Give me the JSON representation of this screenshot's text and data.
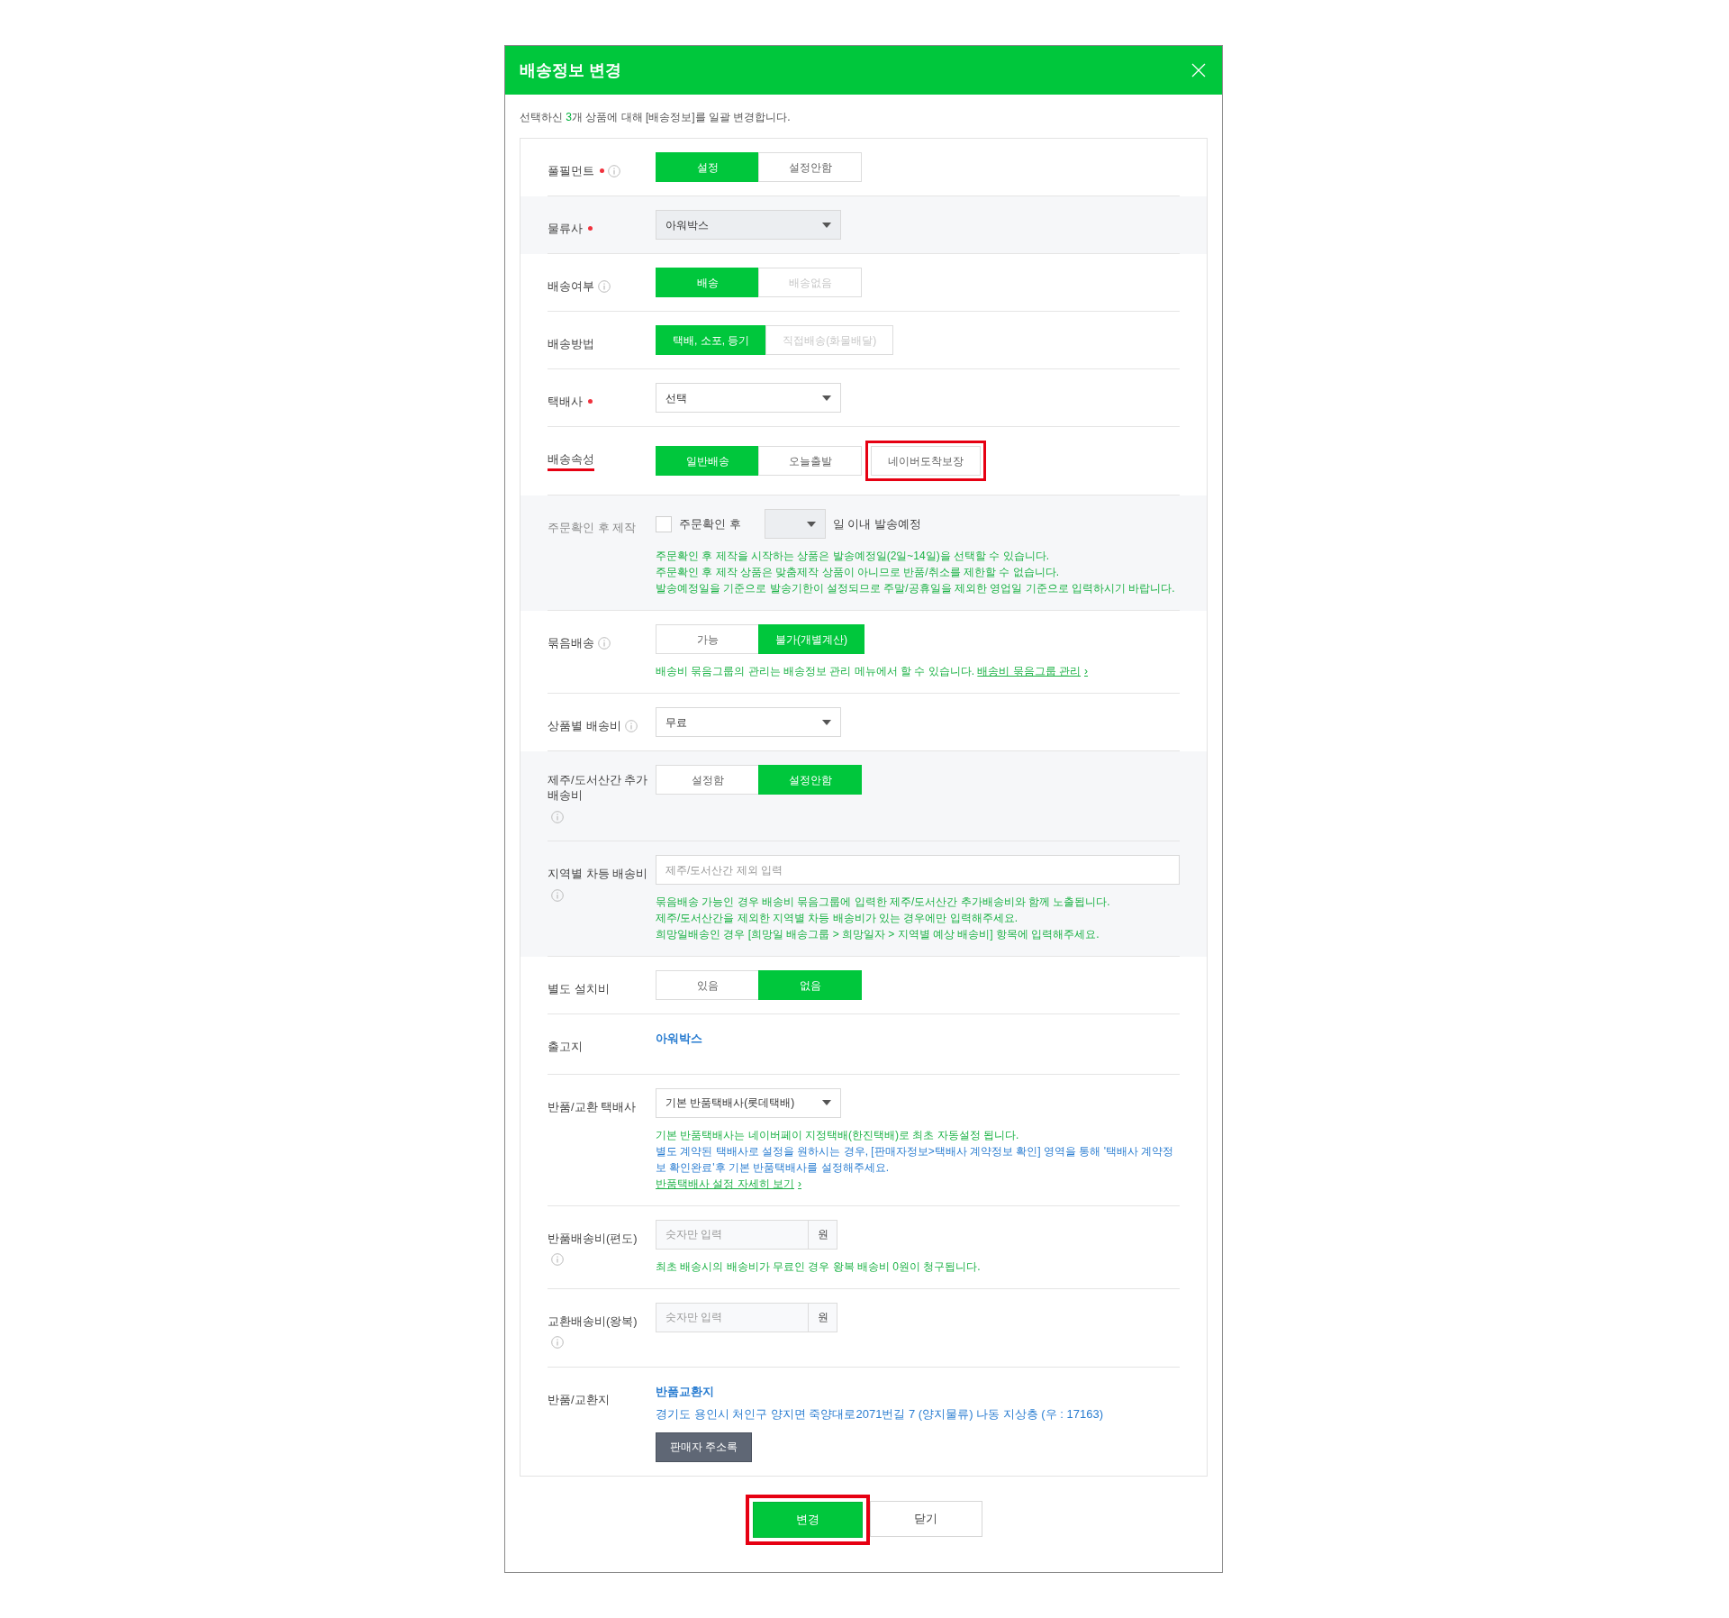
{
  "dialog": {
    "title": "배송정보 변경",
    "intro": {
      "before": "선택하신 ",
      "count": "3",
      "after": "개 상품에 대해 [배송정보]를 일괄 변경합니다."
    }
  },
  "rows": [
    {
      "kind": "segmented",
      "label": "풀필먼트",
      "required": true,
      "info": true,
      "shaded": false,
      "options": [
        {
          "label": "설정",
          "selected": true,
          "disabled": false,
          "highlighted": false
        },
        {
          "label": "설정안함",
          "selected": false,
          "disabled": false,
          "highlighted": false
        }
      ]
    },
    {
      "kind": "select",
      "label": "물류사",
      "required": true,
      "info": false,
      "shaded": true,
      "value": "아워박스",
      "disabled": true
    },
    {
      "kind": "segmented",
      "label": "배송여부",
      "required": false,
      "info": true,
      "shaded": false,
      "options": [
        {
          "label": "배송",
          "selected": true,
          "disabled": false,
          "highlighted": false
        },
        {
          "label": "배송없음",
          "selected": false,
          "disabled": true,
          "highlighted": false
        }
      ]
    },
    {
      "kind": "segmented",
      "label": "배송방법",
      "required": false,
      "info": false,
      "shaded": false,
      "options": [
        {
          "label": "택배, 소포, 등기",
          "selected": true,
          "disabled": false,
          "highlighted": false
        },
        {
          "label": "직접배송(화물배달)",
          "selected": false,
          "disabled": true,
          "highlighted": false
        }
      ]
    },
    {
      "kind": "select",
      "label": "택배사",
      "required": true,
      "info": false,
      "shaded": false,
      "value": "선택",
      "disabled": false
    },
    {
      "kind": "segmented",
      "label": "배송속성",
      "required": false,
      "info": false,
      "shaded": false,
      "underlined": true,
      "options": [
        {
          "label": "일반배송",
          "selected": true,
          "disabled": false,
          "highlighted": false
        },
        {
          "label": "오늘출발",
          "selected": false,
          "disabled": false,
          "highlighted": false
        },
        {
          "label": "네이버도착보장",
          "selected": false,
          "disabled": false,
          "highlighted": true
        }
      ]
    },
    {
      "kind": "lead_time",
      "label": "주문확인 후 제작",
      "muted": true,
      "required": false,
      "info": false,
      "shaded": true,
      "checked": false,
      "checkbox_label": "주문확인 후",
      "select_disabled": true,
      "suffix": "일 이내 발송예정",
      "notes": [
        {
          "text": "주문확인 후 제작을 시작하는 상품은 발송예정일(2일~14일)을 선택할 수 있습니다.",
          "color": "#1bb245"
        },
        {
          "text": "주문확인 후 제작 상품은 맞춤제작 상품이 아니므로 반품/취소를 제한할 수 없습니다.",
          "color": "#1bb245"
        },
        {
          "text": "발송예정일을 기준으로 발송기한이 설정되므로 주말/공휴일을 제외한 영업일 기준으로 입력하시기 바랍니다.",
          "color": "#1bb245"
        }
      ]
    },
    {
      "kind": "segmented",
      "label": "묶음배송",
      "required": false,
      "info": true,
      "shaded": false,
      "options": [
        {
          "label": "가능",
          "selected": false,
          "disabled": false,
          "highlighted": false
        },
        {
          "label": "불가(개별계산)",
          "selected": true,
          "disabled": false,
          "highlighted": false
        }
      ],
      "notes": [
        {
          "text": "배송비 묶음그룹의 관리는 배송정보 관리 메뉴에서 할 수 있습니다.",
          "link": "배송비 묶음그룹 관리",
          "arrow": "›",
          "color": "#1bb245"
        }
      ]
    },
    {
      "kind": "select",
      "label": "상품별 배송비",
      "required": false,
      "info": true,
      "shaded": false,
      "value": "무료",
      "disabled": false
    },
    {
      "kind": "segmented",
      "label": "제주/도서산간 추가 배송비",
      "required": false,
      "info": true,
      "shaded": true,
      "options": [
        {
          "label": "설정함",
          "selected": false,
          "disabled": false,
          "highlighted": false
        },
        {
          "label": "설정안함",
          "selected": true,
          "disabled": false,
          "highlighted": false
        }
      ]
    },
    {
      "kind": "input",
      "label": "지역별 차등 배송비",
      "required": false,
      "info": true,
      "shaded": true,
      "placeholder": "제주/도서산간 제외 입력",
      "notes": [
        {
          "text": "묶음배송 가능인 경우 배송비 묶음그룹에 입력한 제주/도서산간 추가배송비와 함께 노출됩니다.",
          "color": "#1bb245"
        },
        {
          "text": "제주/도서산간을 제외한 지역별 차등 배송비가 있는 경우에만 입력해주세요.",
          "color": "#1bb245"
        },
        {
          "text": "희망일배송인 경우 [희망일 배송그룹 > 희망일자 > 지역별 예상 배송비] 항목에 입력해주세요.",
          "color": "#1bb245"
        }
      ]
    },
    {
      "kind": "segmented",
      "label": "별도 설치비",
      "required": false,
      "info": false,
      "shaded": false,
      "options": [
        {
          "label": "있음",
          "selected": false,
          "disabled": false,
          "highlighted": false
        },
        {
          "label": "없음",
          "selected": true,
          "disabled": false,
          "highlighted": false
        }
      ]
    },
    {
      "kind": "text",
      "label": "출고지",
      "required": false,
      "info": false,
      "shaded": false,
      "value": "아워박스"
    },
    {
      "kind": "select",
      "label": "반품/교환 택배사",
      "required": false,
      "info": false,
      "shaded": false,
      "value": "기본 반품택배사(롯데택배)",
      "disabled": false,
      "notes": [
        {
          "text": "기본 반품택배사는 네이버페이 지정택배(한진택배)로 최초 자동설정 됩니다.",
          "color": "#1bb245"
        },
        {
          "text": "별도 계약된 택배사로 설정을 원하시는 경우, [판매자정보>택배사 계약정보 확인] 영역을 통해 '택배사 계약정보 확인완료'후 기본 반품택배사를 설정해주세요.",
          "color": "#2a7dd1"
        },
        {
          "link": "반품택배사 설정 자세히 보기",
          "arrow": "›",
          "color": "#1bb245"
        }
      ]
    },
    {
      "kind": "amount",
      "label": "반품배송비(편도)",
      "required": false,
      "info": true,
      "shaded": false,
      "placeholder": "숫자만 입력",
      "unit": "원",
      "notes": [
        {
          "text": "최초 배송시의 배송비가 무료인 경우 왕복 배송비 0원이 청구됩니다.",
          "color": "#1bb245"
        }
      ]
    },
    {
      "kind": "amount",
      "label": "교환배송비(왕복)",
      "required": false,
      "info": true,
      "shaded": false,
      "placeholder": "숫자만 입력",
      "unit": "원"
    },
    {
      "kind": "address",
      "label": "반품/교환지",
      "required": false,
      "info": false,
      "shaded": false,
      "title": "반품교환지",
      "address": "경기도 용인시 처인구 양지면 죽양대로2071번길 7 (양지물류) 나동 지상층 (우 : 17163)",
      "button": "판매자 주소록"
    }
  ],
  "footer": [
    {
      "label": "변경",
      "primary": true,
      "highlighted": true
    },
    {
      "label": "닫기",
      "primary": false,
      "highlighted": false
    }
  ]
}
